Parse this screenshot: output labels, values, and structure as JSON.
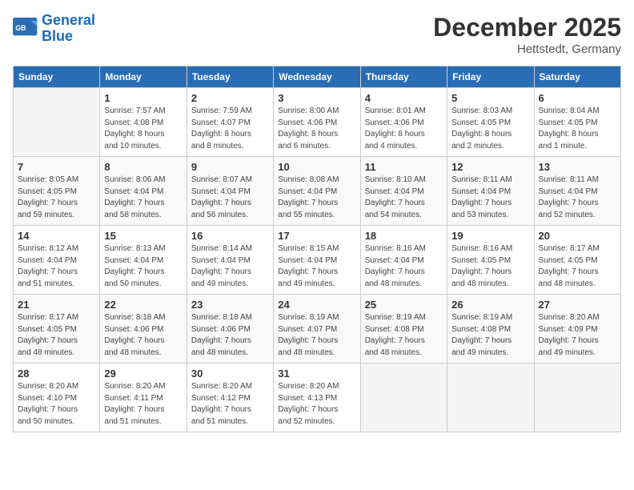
{
  "header": {
    "logo_line1": "General",
    "logo_line2": "Blue",
    "month": "December 2025",
    "location": "Hettstedt, Germany"
  },
  "weekdays": [
    "Sunday",
    "Monday",
    "Tuesday",
    "Wednesday",
    "Thursday",
    "Friday",
    "Saturday"
  ],
  "weeks": [
    [
      {
        "day": "",
        "info": ""
      },
      {
        "day": "1",
        "info": "Sunrise: 7:57 AM\nSunset: 4:08 PM\nDaylight: 8 hours\nand 10 minutes."
      },
      {
        "day": "2",
        "info": "Sunrise: 7:59 AM\nSunset: 4:07 PM\nDaylight: 8 hours\nand 8 minutes."
      },
      {
        "day": "3",
        "info": "Sunrise: 8:00 AM\nSunset: 4:06 PM\nDaylight: 8 hours\nand 6 minutes."
      },
      {
        "day": "4",
        "info": "Sunrise: 8:01 AM\nSunset: 4:06 PM\nDaylight: 8 hours\nand 4 minutes."
      },
      {
        "day": "5",
        "info": "Sunrise: 8:03 AM\nSunset: 4:05 PM\nDaylight: 8 hours\nand 2 minutes."
      },
      {
        "day": "6",
        "info": "Sunrise: 8:04 AM\nSunset: 4:05 PM\nDaylight: 8 hours\nand 1 minute."
      }
    ],
    [
      {
        "day": "7",
        "info": "Sunrise: 8:05 AM\nSunset: 4:05 PM\nDaylight: 7 hours\nand 59 minutes."
      },
      {
        "day": "8",
        "info": "Sunrise: 8:06 AM\nSunset: 4:04 PM\nDaylight: 7 hours\nand 58 minutes."
      },
      {
        "day": "9",
        "info": "Sunrise: 8:07 AM\nSunset: 4:04 PM\nDaylight: 7 hours\nand 56 minutes."
      },
      {
        "day": "10",
        "info": "Sunrise: 8:08 AM\nSunset: 4:04 PM\nDaylight: 7 hours\nand 55 minutes."
      },
      {
        "day": "11",
        "info": "Sunrise: 8:10 AM\nSunset: 4:04 PM\nDaylight: 7 hours\nand 54 minutes."
      },
      {
        "day": "12",
        "info": "Sunrise: 8:11 AM\nSunset: 4:04 PM\nDaylight: 7 hours\nand 53 minutes."
      },
      {
        "day": "13",
        "info": "Sunrise: 8:11 AM\nSunset: 4:04 PM\nDaylight: 7 hours\nand 52 minutes."
      }
    ],
    [
      {
        "day": "14",
        "info": "Sunrise: 8:12 AM\nSunset: 4:04 PM\nDaylight: 7 hours\nand 51 minutes."
      },
      {
        "day": "15",
        "info": "Sunrise: 8:13 AM\nSunset: 4:04 PM\nDaylight: 7 hours\nand 50 minutes."
      },
      {
        "day": "16",
        "info": "Sunrise: 8:14 AM\nSunset: 4:04 PM\nDaylight: 7 hours\nand 49 minutes."
      },
      {
        "day": "17",
        "info": "Sunrise: 8:15 AM\nSunset: 4:04 PM\nDaylight: 7 hours\nand 49 minutes."
      },
      {
        "day": "18",
        "info": "Sunrise: 8:16 AM\nSunset: 4:04 PM\nDaylight: 7 hours\nand 48 minutes."
      },
      {
        "day": "19",
        "info": "Sunrise: 8:16 AM\nSunset: 4:05 PM\nDaylight: 7 hours\nand 48 minutes."
      },
      {
        "day": "20",
        "info": "Sunrise: 8:17 AM\nSunset: 4:05 PM\nDaylight: 7 hours\nand 48 minutes."
      }
    ],
    [
      {
        "day": "21",
        "info": "Sunrise: 8:17 AM\nSunset: 4:05 PM\nDaylight: 7 hours\nand 48 minutes."
      },
      {
        "day": "22",
        "info": "Sunrise: 8:18 AM\nSunset: 4:06 PM\nDaylight: 7 hours\nand 48 minutes."
      },
      {
        "day": "23",
        "info": "Sunrise: 8:18 AM\nSunset: 4:06 PM\nDaylight: 7 hours\nand 48 minutes."
      },
      {
        "day": "24",
        "info": "Sunrise: 8:19 AM\nSunset: 4:07 PM\nDaylight: 7 hours\nand 48 minutes."
      },
      {
        "day": "25",
        "info": "Sunrise: 8:19 AM\nSunset: 4:08 PM\nDaylight: 7 hours\nand 48 minutes."
      },
      {
        "day": "26",
        "info": "Sunrise: 8:19 AM\nSunset: 4:08 PM\nDaylight: 7 hours\nand 49 minutes."
      },
      {
        "day": "27",
        "info": "Sunrise: 8:20 AM\nSunset: 4:09 PM\nDaylight: 7 hours\nand 49 minutes."
      }
    ],
    [
      {
        "day": "28",
        "info": "Sunrise: 8:20 AM\nSunset: 4:10 PM\nDaylight: 7 hours\nand 50 minutes."
      },
      {
        "day": "29",
        "info": "Sunrise: 8:20 AM\nSunset: 4:11 PM\nDaylight: 7 hours\nand 51 minutes."
      },
      {
        "day": "30",
        "info": "Sunrise: 8:20 AM\nSunset: 4:12 PM\nDaylight: 7 hours\nand 51 minutes."
      },
      {
        "day": "31",
        "info": "Sunrise: 8:20 AM\nSunset: 4:13 PM\nDaylight: 7 hours\nand 52 minutes."
      },
      {
        "day": "",
        "info": ""
      },
      {
        "day": "",
        "info": ""
      },
      {
        "day": "",
        "info": ""
      }
    ]
  ]
}
